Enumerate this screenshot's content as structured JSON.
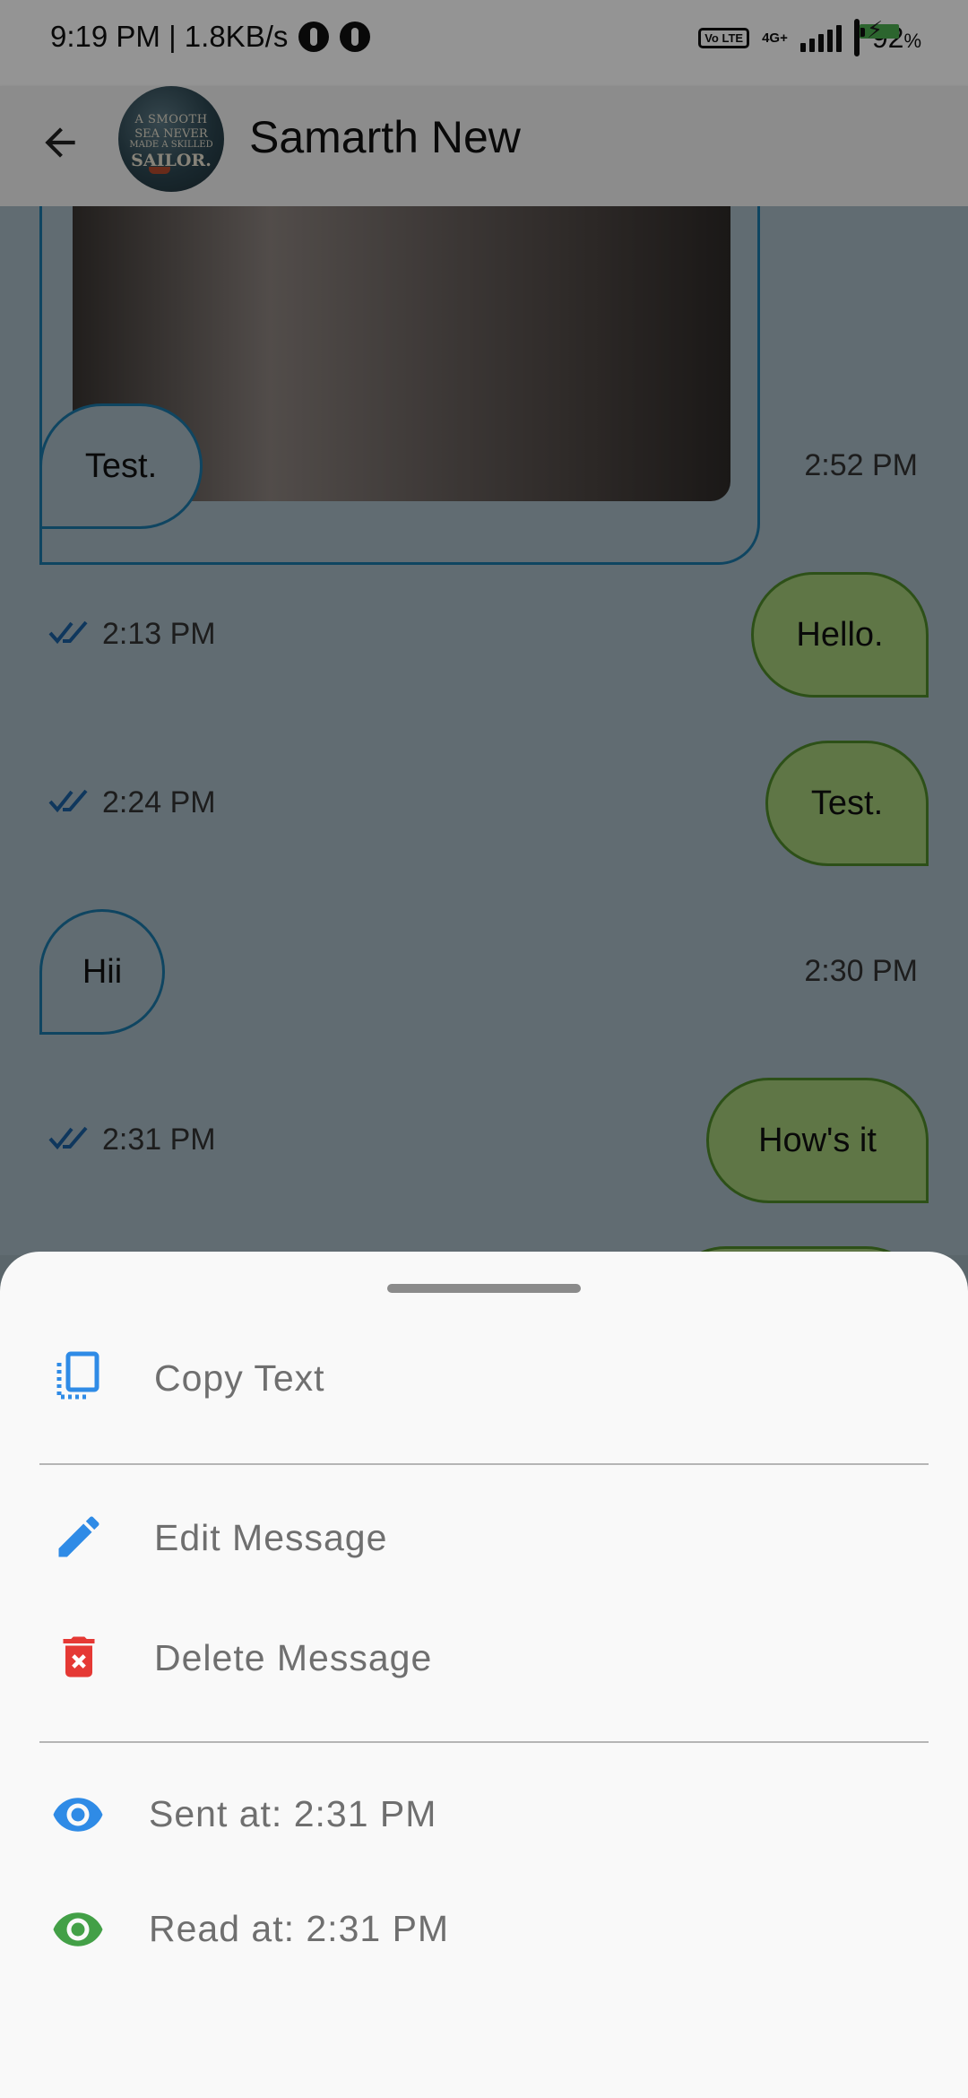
{
  "status_bar": {
    "time_speed": "9:19 PM | 1.8KB/s",
    "volte": "Vo LTE",
    "network": "4G+",
    "battery_percent": "92",
    "battery_suffix": "%"
  },
  "header": {
    "contact_name": "Samarth New",
    "avatar_lines": [
      "A SMOOTH",
      "SEA NEVER",
      "MADE A SKILLED",
      "SAILOR."
    ]
  },
  "messages": [
    {
      "direction": "incoming",
      "text": "Test.",
      "time": "2:52 PM"
    },
    {
      "direction": "outgoing",
      "text": "Hello.",
      "time": "2:13 PM"
    },
    {
      "direction": "outgoing",
      "text": "Test.",
      "time": "2:24 PM"
    },
    {
      "direction": "incoming",
      "text": "Hii",
      "time": "2:30 PM"
    },
    {
      "direction": "outgoing",
      "text": "How's it",
      "time": "2:31 PM"
    }
  ],
  "sheet": {
    "copy_label": "Copy Text",
    "edit_label": "Edit Message",
    "delete_label": "Delete Message",
    "sent_label": "Sent at: 2:31 PM",
    "read_label": "Read at: 2:31 PM"
  },
  "colors": {
    "incoming_border": "#1a78a8",
    "outgoing_fill": "#a4cc79",
    "copy_icon": "#2f8be6",
    "edit_icon": "#2f8be6",
    "delete_icon": "#e53935",
    "sent_icon": "#2f8be6",
    "read_icon": "#43a047"
  },
  "icons": {
    "back": "arrow-back-icon",
    "copy": "copy-icon",
    "edit": "pencil-icon",
    "delete": "trash-icon",
    "sent": "eye-icon",
    "read": "eye-icon",
    "ticks": "double-check-icon"
  }
}
